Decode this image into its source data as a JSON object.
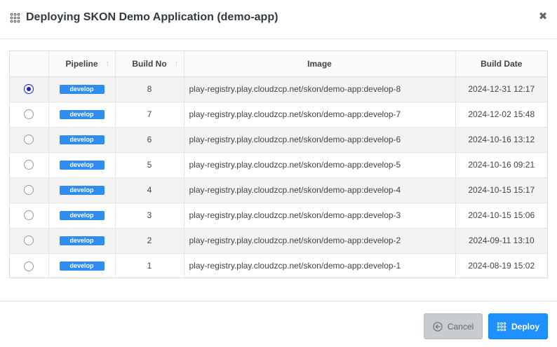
{
  "dialog": {
    "title": "Deploying SKON Demo Application (demo-app)",
    "close_icon": "close-icon",
    "title_icon": "grid-dots-icon"
  },
  "table": {
    "columns": [
      "",
      "Pipeline",
      "Build No",
      "Image",
      "Build Date"
    ],
    "rows": [
      {
        "selected": true,
        "pipeline": "develop",
        "build_no": "8",
        "image": "play-registry.play.cloudzcp.net/skon/demo-app:develop-8",
        "build_date": "2024-12-31 12:17"
      },
      {
        "selected": false,
        "pipeline": "develop",
        "build_no": "7",
        "image": "play-registry.play.cloudzcp.net/skon/demo-app:develop-7",
        "build_date": "2024-12-02 15:48"
      },
      {
        "selected": false,
        "pipeline": "develop",
        "build_no": "6",
        "image": "play-registry.play.cloudzcp.net/skon/demo-app:develop-6",
        "build_date": "2024-10-16 13:12"
      },
      {
        "selected": false,
        "pipeline": "develop",
        "build_no": "5",
        "image": "play-registry.play.cloudzcp.net/skon/demo-app:develop-5",
        "build_date": "2024-10-16 09:21"
      },
      {
        "selected": false,
        "pipeline": "develop",
        "build_no": "4",
        "image": "play-registry.play.cloudzcp.net/skon/demo-app:develop-4",
        "build_date": "2024-10-15 15:17"
      },
      {
        "selected": false,
        "pipeline": "develop",
        "build_no": "3",
        "image": "play-registry.play.cloudzcp.net/skon/demo-app:develop-3",
        "build_date": "2024-10-15 15:06"
      },
      {
        "selected": false,
        "pipeline": "develop",
        "build_no": "2",
        "image": "play-registry.play.cloudzcp.net/skon/demo-app:develop-2",
        "build_date": "2024-09-11 13:10"
      },
      {
        "selected": false,
        "pipeline": "develop",
        "build_no": "1",
        "image": "play-registry.play.cloudzcp.net/skon/demo-app:develop-1",
        "build_date": "2024-08-19 15:02"
      }
    ]
  },
  "footer": {
    "cancel_label": "Cancel",
    "deploy_label": "Deploy"
  },
  "colors": {
    "accent": "#1e90ff",
    "badge": "#2f8cf0",
    "radio_selected": "#1a1ae0"
  }
}
